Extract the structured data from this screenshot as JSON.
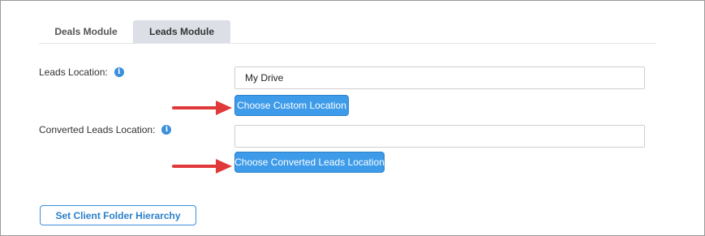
{
  "tabs": [
    {
      "label": "Deals Module"
    },
    {
      "label": "Leads Module"
    }
  ],
  "leads_location": {
    "label": "Leads Location:",
    "value": "My Drive",
    "button_label": "Choose Custom Location"
  },
  "converted_leads_location": {
    "label": "Converted Leads Location:",
    "value": "",
    "button_label": "Choose Converted Leads Location"
  },
  "hierarchy_button_label": "Set Client Folder Hierarchy",
  "colors": {
    "primary_button": "#3d9be9",
    "arrow": "#e0393a",
    "info_icon": "#3b8fdc",
    "active_tab": "#dcdfe6"
  }
}
